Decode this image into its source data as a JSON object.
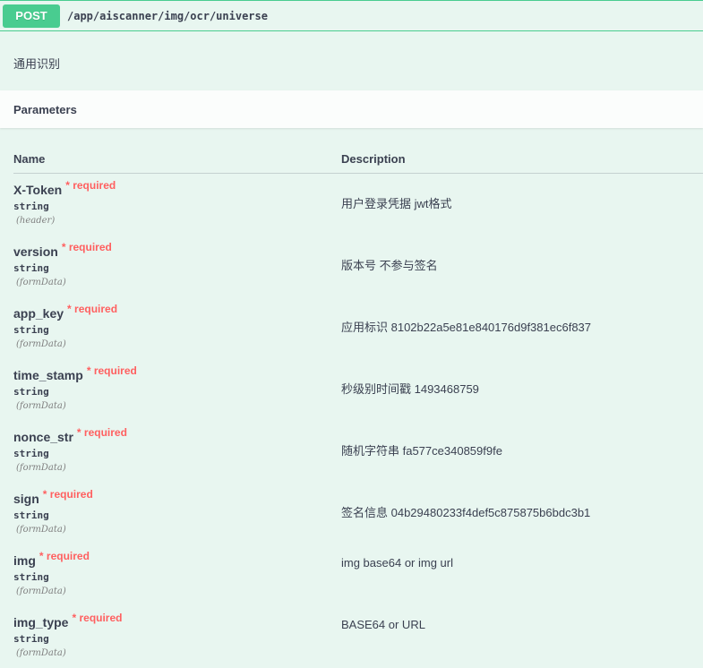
{
  "operation": {
    "method": "POST",
    "path": "/app/aiscanner/img/ocr/universe",
    "description": "通用识别"
  },
  "parameters": {
    "section_title": "Parameters",
    "headers": {
      "name": "Name",
      "description": "Description"
    },
    "required_label": "* required",
    "items": [
      {
        "name": "X-Token",
        "type": "string",
        "in": "(header)",
        "description": "用户登录凭据 jwt格式"
      },
      {
        "name": "version",
        "type": "string",
        "in": "(formData)",
        "description": "版本号 不参与签名"
      },
      {
        "name": "app_key",
        "type": "string",
        "in": "(formData)",
        "description": "应用标识 8102b22a5e81e840176d9f381ec6f837"
      },
      {
        "name": "time_stamp",
        "type": "string",
        "in": "(formData)",
        "description": "秒级别时间戳 1493468759"
      },
      {
        "name": "nonce_str",
        "type": "string",
        "in": "(formData)",
        "description": "随机字符串 fa577ce340859f9fe"
      },
      {
        "name": "sign",
        "type": "string",
        "in": "(formData)",
        "description": "签名信息 04b29480233f4def5c875875b6bdc3b1"
      },
      {
        "name": "img",
        "type": "string",
        "in": "(formData)",
        "description": "img base64 or img url"
      },
      {
        "name": "img_type",
        "type": "string",
        "in": "(formData)",
        "description": "BASE64 or URL"
      }
    ]
  },
  "colors": {
    "accent": "#49cc90",
    "background": "#e8f6f0",
    "required": "#ff6060"
  }
}
